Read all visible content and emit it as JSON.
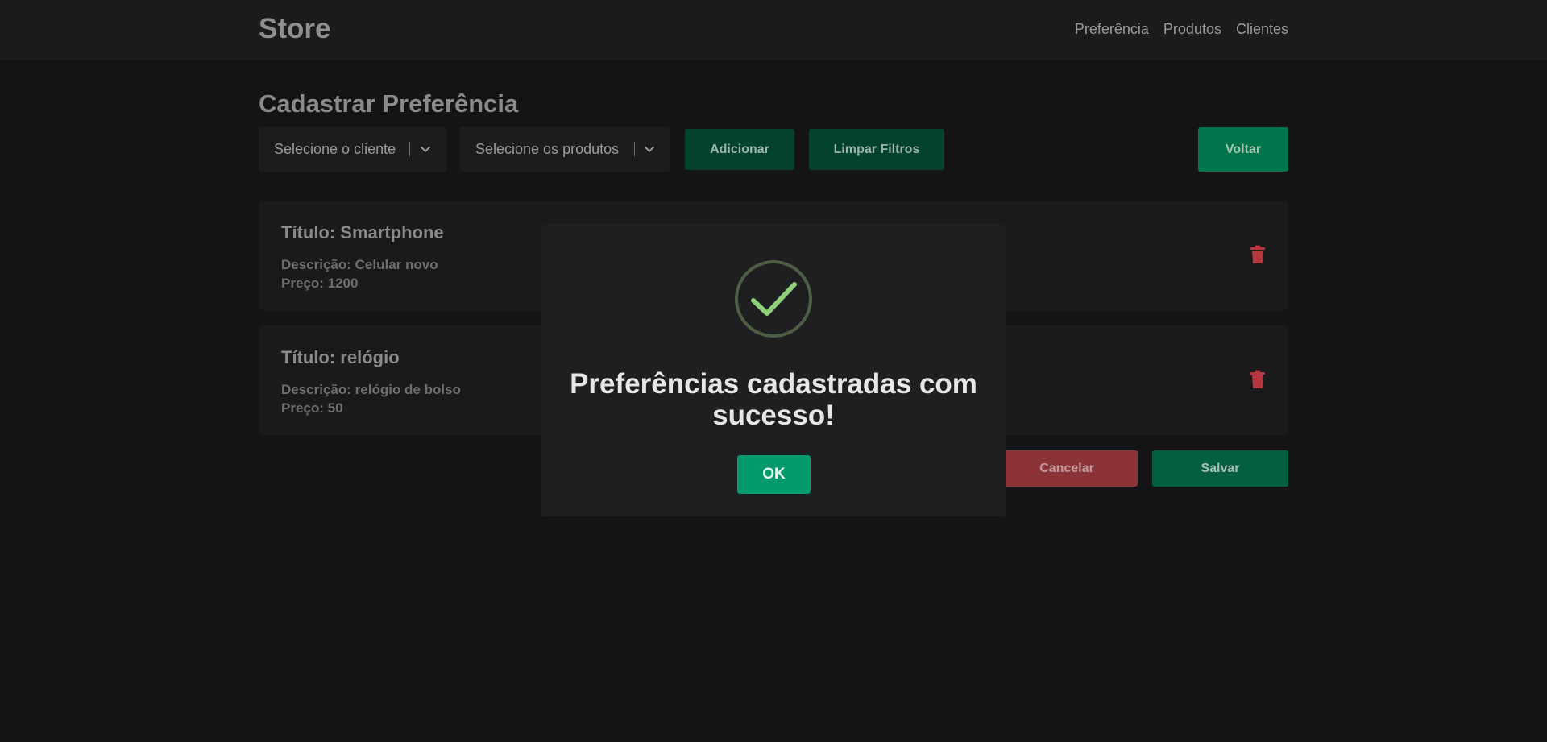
{
  "navbar": {
    "brand": "Store",
    "links": [
      "Preferência",
      "Produtos",
      "Clientes"
    ]
  },
  "page": {
    "title": "Cadastrar Preferência"
  },
  "filters": {
    "client_select": "Selecione o cliente",
    "products_select": "Selecione os produtos",
    "add_label": "Adicionar",
    "clear_label": "Limpar Filtros",
    "back_label": "Voltar"
  },
  "products": [
    {
      "title": "Título: Smartphone",
      "description": "Descrição: Celular novo",
      "price": "Preço: 1200"
    },
    {
      "title": "Título: relógio",
      "description": "Descrição: relógio de bolso",
      "price": "Preço: 50"
    }
  ],
  "actions": {
    "cancel_label": "Cancelar",
    "save_label": "Salvar"
  },
  "modal": {
    "icon": "check-icon",
    "message": "Preferências cadastradas com sucesso!",
    "ok_label": "OK"
  },
  "colors": {
    "background": "#141416",
    "accent_green": "#04996a",
    "danger_red": "#8c3338",
    "check_green": "#8fd17a"
  }
}
